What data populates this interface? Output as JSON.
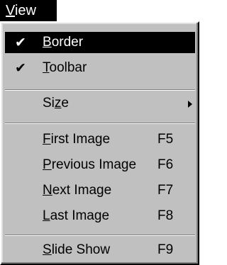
{
  "menubar": {
    "title_mnemonic": "V",
    "title_rest": "iew"
  },
  "menu": {
    "items": [
      {
        "mnemonic": "B",
        "rest": "order",
        "checked": true,
        "check_glyph": "✔",
        "highlighted": true
      },
      {
        "mnemonic": "T",
        "rest": "oolbar",
        "checked": true,
        "check_glyph": "✔",
        "highlighted": false
      },
      {
        "pre": "Si",
        "mnemonic": "z",
        "rest": "e",
        "has_submenu": true,
        "icon": "submenu-arrow-icon"
      },
      {
        "mnemonic": "F",
        "rest": "irst Image",
        "shortcut": "F5"
      },
      {
        "mnemonic": "P",
        "rest": "revious Image",
        "shortcut": "F6"
      },
      {
        "mnemonic": "N",
        "rest": "ext Image",
        "shortcut": "F7"
      },
      {
        "mnemonic": "L",
        "rest": "ast Image",
        "shortcut": "F8"
      },
      {
        "mnemonic": "S",
        "rest": "lide Show",
        "shortcut": "F9"
      }
    ]
  },
  "colors": {
    "menu_background": "#c0c0c0",
    "highlight_background": "#000000",
    "highlight_text": "#ffffff"
  }
}
